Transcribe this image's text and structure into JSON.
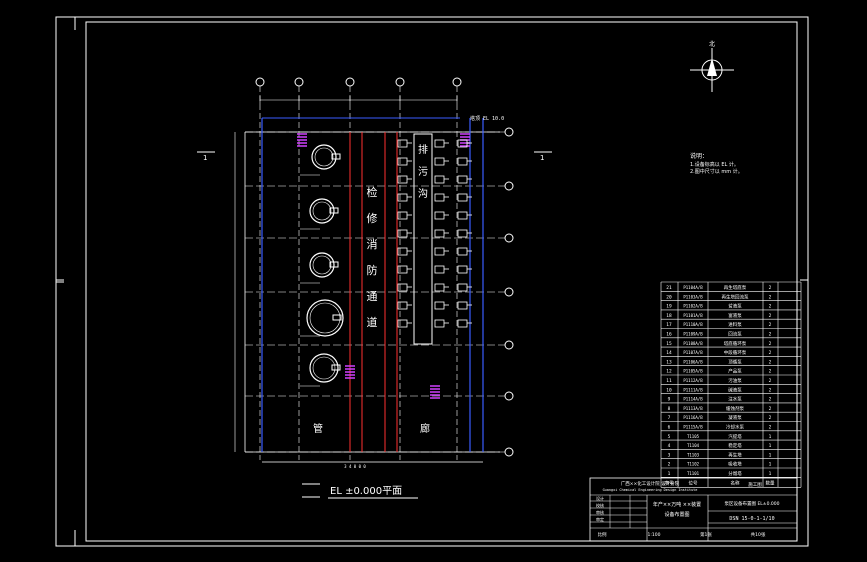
{
  "drawing": {
    "plan_title": "EL ±0.000平面",
    "north_label": "北",
    "labels": {
      "sewage_trench": [
        "排",
        "污",
        "沟"
      ],
      "maintenance_channel": [
        "检",
        "修",
        "消",
        "防",
        "通",
        "道"
      ],
      "pipe_gallery": [
        "管",
        "廊"
      ]
    },
    "elevation_note": "塔顶 EL 10.0",
    "notes_title": "说明：",
    "notes": [
      "1.设备标高以 EL 计。",
      "2.图中尺寸以 mm 计。"
    ],
    "equipment_table": {
      "rows": [
        {
          "no": "21",
          "tag": "P1104A/B",
          "name": "再生塔底泵",
          "qty": "2"
        },
        {
          "no": "20",
          "tag": "P1103A/B",
          "name": "再生塔回流泵",
          "qty": "2"
        },
        {
          "no": "19",
          "tag": "P1102A/B",
          "name": "贫液泵",
          "qty": "2"
        },
        {
          "no": "18",
          "tag": "P1101A/B",
          "name": "富液泵",
          "qty": "2"
        },
        {
          "no": "17",
          "tag": "P1110A/B",
          "name": "进料泵",
          "qty": "2"
        },
        {
          "no": "16",
          "tag": "P1109A/B",
          "name": "回流泵",
          "qty": "2"
        },
        {
          "no": "15",
          "tag": "P1108A/B",
          "name": "塔底循环泵",
          "qty": "2"
        },
        {
          "no": "14",
          "tag": "P1107A/B",
          "name": "中段循环泵",
          "qty": "2"
        },
        {
          "no": "13",
          "tag": "P1106A/B",
          "name": "顶循泵",
          "qty": "2"
        },
        {
          "no": "12",
          "tag": "P1105A/B",
          "name": "产品泵",
          "qty": "2"
        },
        {
          "no": "11",
          "tag": "P1112A/B",
          "name": "污油泵",
          "qty": "2"
        },
        {
          "no": "10",
          "tag": "P1111A/B",
          "name": "碱液泵",
          "qty": "2"
        },
        {
          "no": "9",
          "tag": "P1114A/B",
          "name": "注水泵",
          "qty": "2"
        },
        {
          "no": "8",
          "tag": "P1113A/B",
          "name": "缓蚀剂泵",
          "qty": "2"
        },
        {
          "no": "7",
          "tag": "P1116A/B",
          "name": "凝液泵",
          "qty": "2"
        },
        {
          "no": "6",
          "tag": "P1115A/B",
          "name": "冷却水泵",
          "qty": "2"
        },
        {
          "no": "5",
          "tag": "T1105",
          "name": "汽提塔",
          "qty": "1"
        },
        {
          "no": "4",
          "tag": "T1104",
          "name": "稳定塔",
          "qty": "1"
        },
        {
          "no": "3",
          "tag": "T1103",
          "name": "再生塔",
          "qty": "1"
        },
        {
          "no": "2",
          "tag": "T1102",
          "name": "吸收塔",
          "qty": "1"
        },
        {
          "no": "1",
          "tag": "T1101",
          "name": "分馏塔",
          "qty": "1"
        }
      ],
      "header": {
        "no": "序号",
        "tag": "位号",
        "name": "名称",
        "qty": "数量"
      }
    },
    "title_block": {
      "company": "广西××化工设计院 设计分院",
      "company_en": "Guangxi Chemical Engineering Design Institute",
      "project": "年产××万吨 ××装置",
      "drawing_name": "设备布置图",
      "stage": "施工图",
      "sheet_title": "泵区设备布置图 EL±0.000",
      "drawing_no": "DSN 15-0-1-1/10",
      "rows_left": [
        "设计",
        "校核",
        "审核",
        "审定"
      ],
      "footer": [
        "比例",
        "1:100",
        "第1张",
        "共10张"
      ]
    }
  }
}
